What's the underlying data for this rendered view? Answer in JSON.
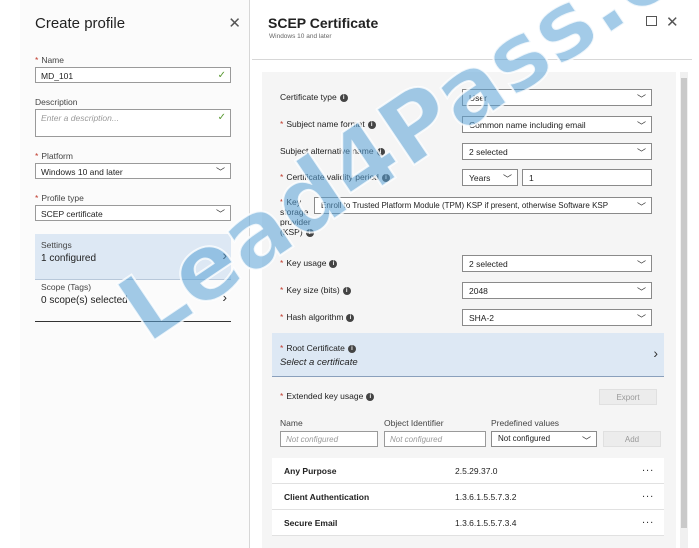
{
  "left": {
    "title": "Create profile",
    "name_label": "Name",
    "name_value": "MD_101",
    "desc_label": "Description",
    "desc_placeholder": "Enter a description...",
    "platform_label": "Platform",
    "platform_value": "Windows 10 and later",
    "ptype_label": "Profile type",
    "ptype_value": "SCEP certificate",
    "settings_title": "Settings",
    "settings_value": "1 configured",
    "scope_title": "Scope (Tags)",
    "scope_value": "0 scope(s) selected"
  },
  "right": {
    "title": "SCEP Certificate",
    "subtitle": "Windows 10 and later",
    "cert_type_label": "Certificate type",
    "cert_type_value": "User",
    "subject_label": "Subject name format",
    "subject_value": "Common name including email",
    "san_label": "Subject alternative name",
    "san_value": "2 selected",
    "validity_label": "Certificate validity period",
    "validity_unit": "Years",
    "validity_value": "1",
    "ksp_label_1": "Key",
    "ksp_label_2": "storage",
    "ksp_label_3": "provider",
    "ksp_label_4": "(KSP)",
    "ksp_value": "Enroll to Trusted Platform Module (TPM) KSP if present, otherwise Software KSP",
    "key_usage_label": "Key usage",
    "key_usage_value": "2 selected",
    "key_size_label": "Key size (bits)",
    "key_size_value": "2048",
    "hash_label": "Hash algorithm",
    "hash_value": "SHA-2",
    "root_label": "Root Certificate",
    "root_value": "Select a certificate",
    "eku_label": "Extended key usage",
    "export_label": "Export",
    "col_name": "Name",
    "col_oid": "Object Identifier",
    "col_pre": "Predefined values",
    "name_placeholder": "Not configured",
    "oid_placeholder": "Not configured",
    "predefined_value": "Not configured",
    "add_label": "Add",
    "eku_rows": [
      {
        "name": "Any Purpose",
        "oid": "2.5.29.37.0"
      },
      {
        "name": "Client Authentication",
        "oid": "1.3.6.1.5.5.7.3.2"
      },
      {
        "name": "Secure Email",
        "oid": "1.3.6.1.5.5.7.3.4"
      }
    ],
    "more": "..."
  },
  "watermark": "Lead4Pass.com"
}
